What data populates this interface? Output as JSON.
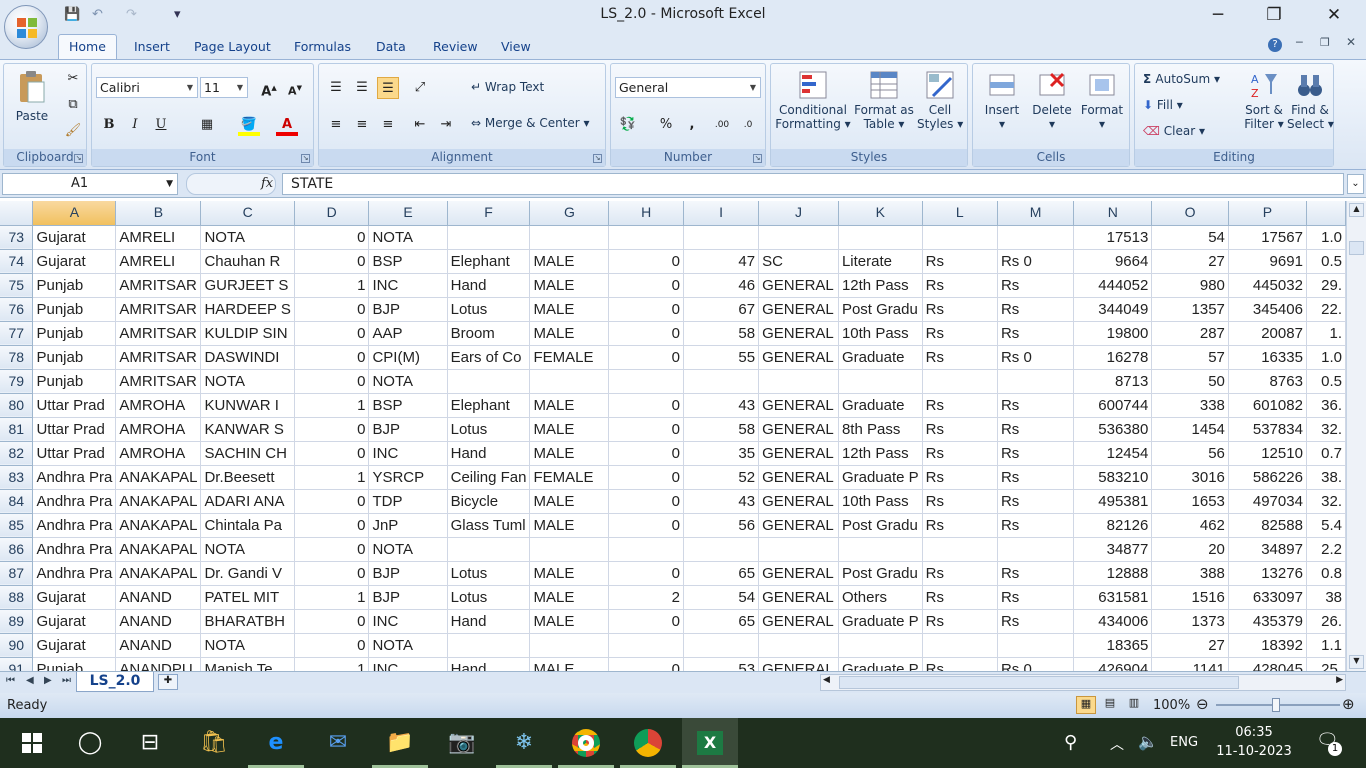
{
  "window": {
    "title": "LS_2.0 - Microsoft Excel",
    "minimize": "─",
    "restore": "❐",
    "close": "✕"
  },
  "qat": {
    "save": "💾",
    "undo": "↶",
    "redo": "↷",
    "customize": "▾"
  },
  "tabs": [
    "Home",
    "Insert",
    "Page Layout",
    "Formulas",
    "Data",
    "Review",
    "View"
  ],
  "ribbon": {
    "clipboard": {
      "label": "Clipboard",
      "paste": "Paste"
    },
    "font": {
      "label": "Font",
      "name": "Calibri",
      "size": "11",
      "bold": "B",
      "italic": "I",
      "underline": "U",
      "grow": "A",
      "shrink": "A"
    },
    "alignment": {
      "label": "Alignment",
      "wrap": "Wrap Text",
      "merge": "Merge & Center"
    },
    "number": {
      "label": "Number",
      "format": "General",
      "percent": "%",
      "comma": ",",
      "inc_dec": ".00",
      "dec_dec": ".0"
    },
    "styles": {
      "label": "Styles",
      "conditional": "Conditional",
      "conditional2": "Formatting",
      "format_table": "Format as",
      "format_table2": "Table",
      "cell_styles": "Cell",
      "cell_styles2": "Styles"
    },
    "cells": {
      "label": "Cells",
      "insert": "Insert",
      "delete": "Delete",
      "format": "Format"
    },
    "editing": {
      "label": "Editing",
      "autosum": "AutoSum",
      "fill": "Fill",
      "clear": "Clear",
      "sort": "Sort &",
      "sort2": "Filter",
      "find": "Find &",
      "find2": "Select"
    }
  },
  "formula_bar": {
    "cell_ref": "A1",
    "fx": "fx",
    "value": "STATE"
  },
  "columns": [
    "A",
    "B",
    "C",
    "D",
    "E",
    "F",
    "G",
    "H",
    "I",
    "J",
    "K",
    "L",
    "M",
    "N",
    "O",
    "P",
    ""
  ],
  "rows": [
    {
      "n": "73",
      "c": [
        "Gujarat",
        "AMRELI",
        "NOTA",
        "0",
        "NOTA",
        "",
        "",
        "",
        "",
        "",
        "",
        "",
        "",
        "17513",
        "54",
        "17567",
        "1.0"
      ]
    },
    {
      "n": "74",
      "c": [
        "Gujarat",
        "AMRELI",
        "Chauhan R",
        "0",
        "BSP",
        "Elephant",
        "MALE",
        "0",
        "47",
        "SC",
        "Literate",
        "Rs",
        "Rs 0",
        "9664",
        "27",
        "9691",
        "0.5"
      ]
    },
    {
      "n": "75",
      "c": [
        "Punjab",
        "AMRITSAR",
        "GURJEET S",
        "1",
        "INC",
        "Hand",
        "MALE",
        "0",
        "46",
        "GENERAL",
        "12th Pass",
        "Rs",
        "Rs",
        "444052",
        "980",
        "445032",
        "29."
      ]
    },
    {
      "n": "76",
      "c": [
        "Punjab",
        "AMRITSAR",
        "HARDEEP S",
        "0",
        "BJP",
        "Lotus",
        "MALE",
        "0",
        "67",
        "GENERAL",
        "Post Gradu",
        "Rs",
        "Rs",
        "344049",
        "1357",
        "345406",
        "22."
      ]
    },
    {
      "n": "77",
      "c": [
        "Punjab",
        "AMRITSAR",
        "KULDIP SIN",
        "0",
        "AAP",
        "Broom",
        "MALE",
        "0",
        "58",
        "GENERAL",
        "10th Pass",
        "Rs",
        "Rs",
        "19800",
        "287",
        "20087",
        "1."
      ]
    },
    {
      "n": "78",
      "c": [
        "Punjab",
        "AMRITSAR",
        "DASWINDI",
        "0",
        "CPI(M)",
        "Ears of Co",
        "FEMALE",
        "0",
        "55",
        "GENERAL",
        "Graduate",
        "Rs",
        "Rs 0",
        "16278",
        "57",
        "16335",
        "1.0"
      ]
    },
    {
      "n": "79",
      "c": [
        "Punjab",
        "AMRITSAR",
        "NOTA",
        "0",
        "NOTA",
        "",
        "",
        "",
        "",
        "",
        "",
        "",
        "",
        "8713",
        "50",
        "8763",
        "0.5"
      ]
    },
    {
      "n": "80",
      "c": [
        "Uttar Prad",
        "AMROHA",
        "KUNWAR I",
        "1",
        "BSP",
        "Elephant",
        "MALE",
        "0",
        "43",
        "GENERAL",
        "Graduate",
        "Rs",
        "Rs",
        "600744",
        "338",
        "601082",
        "36."
      ]
    },
    {
      "n": "81",
      "c": [
        "Uttar Prad",
        "AMROHA",
        "KANWAR S",
        "0",
        "BJP",
        "Lotus",
        "MALE",
        "0",
        "58",
        "GENERAL",
        "8th Pass",
        "Rs",
        "Rs",
        "536380",
        "1454",
        "537834",
        "32."
      ]
    },
    {
      "n": "82",
      "c": [
        "Uttar Prad",
        "AMROHA",
        "SACHIN CH",
        "0",
        "INC",
        "Hand",
        "MALE",
        "0",
        "35",
        "GENERAL",
        "12th Pass",
        "Rs",
        "Rs",
        "12454",
        "56",
        "12510",
        "0.7"
      ]
    },
    {
      "n": "83",
      "c": [
        "Andhra Pra",
        "ANAKAPAL",
        "Dr.Beesett",
        "1",
        "YSRCP",
        "Ceiling Fan",
        "FEMALE",
        "0",
        "52",
        "GENERAL",
        "Graduate P",
        "Rs",
        "Rs",
        "583210",
        "3016",
        "586226",
        "38."
      ]
    },
    {
      "n": "84",
      "c": [
        "Andhra Pra",
        "ANAKAPAL",
        "ADARI ANA",
        "0",
        "TDP",
        "Bicycle",
        "MALE",
        "0",
        "43",
        "GENERAL",
        "10th Pass",
        "Rs",
        "Rs",
        "495381",
        "1653",
        "497034",
        "32."
      ]
    },
    {
      "n": "85",
      "c": [
        "Andhra Pra",
        "ANAKAPAL",
        "Chintala Pa",
        "0",
        "JnP",
        "Glass Tuml",
        "MALE",
        "0",
        "56",
        "GENERAL",
        "Post Gradu",
        "Rs",
        "Rs",
        "82126",
        "462",
        "82588",
        "5.4"
      ]
    },
    {
      "n": "86",
      "c": [
        "Andhra Pra",
        "ANAKAPAL",
        "NOTA",
        "0",
        "NOTA",
        "",
        "",
        "",
        "",
        "",
        "",
        "",
        "",
        "34877",
        "20",
        "34897",
        "2.2"
      ]
    },
    {
      "n": "87",
      "c": [
        "Andhra Pra",
        "ANAKAPAL",
        "Dr. Gandi V",
        "0",
        "BJP",
        "Lotus",
        "MALE",
        "0",
        "65",
        "GENERAL",
        "Post Gradu",
        "Rs",
        "Rs",
        "12888",
        "388",
        "13276",
        "0.8"
      ]
    },
    {
      "n": "88",
      "c": [
        "Gujarat",
        "ANAND",
        "PATEL MIT",
        "1",
        "BJP",
        "Lotus",
        "MALE",
        "2",
        "54",
        "GENERAL",
        "Others",
        "Rs",
        "Rs",
        "631581",
        "1516",
        "633097",
        "38"
      ]
    },
    {
      "n": "89",
      "c": [
        "Gujarat",
        "ANAND",
        "BHARATBH",
        "0",
        "INC",
        "Hand",
        "MALE",
        "0",
        "65",
        "GENERAL",
        "Graduate P",
        "Rs",
        "Rs",
        "434006",
        "1373",
        "435379",
        "26."
      ]
    },
    {
      "n": "90",
      "c": [
        "Gujarat",
        "ANAND",
        "NOTA",
        "0",
        "NOTA",
        "",
        "",
        "",
        "",
        "",
        "",
        "",
        "",
        "18365",
        "27",
        "18392",
        "1.1"
      ]
    },
    {
      "n": "91",
      "c": [
        "Punjab",
        "ANANDPU",
        "Manish Te",
        "1",
        "INC",
        "Hand",
        "MALE",
        "0",
        "53",
        "GENERAL",
        "Graduate P",
        "Rs",
        "Rs 0",
        "426904",
        "1141",
        "428045",
        "25."
      ]
    }
  ],
  "sheet_tab": "LS_2.0",
  "status": {
    "ready": "Ready",
    "zoom": "100%"
  },
  "taskbar": {
    "lang": "ENG",
    "time": "06:35",
    "date": "11-10-2023",
    "notif": "1"
  }
}
